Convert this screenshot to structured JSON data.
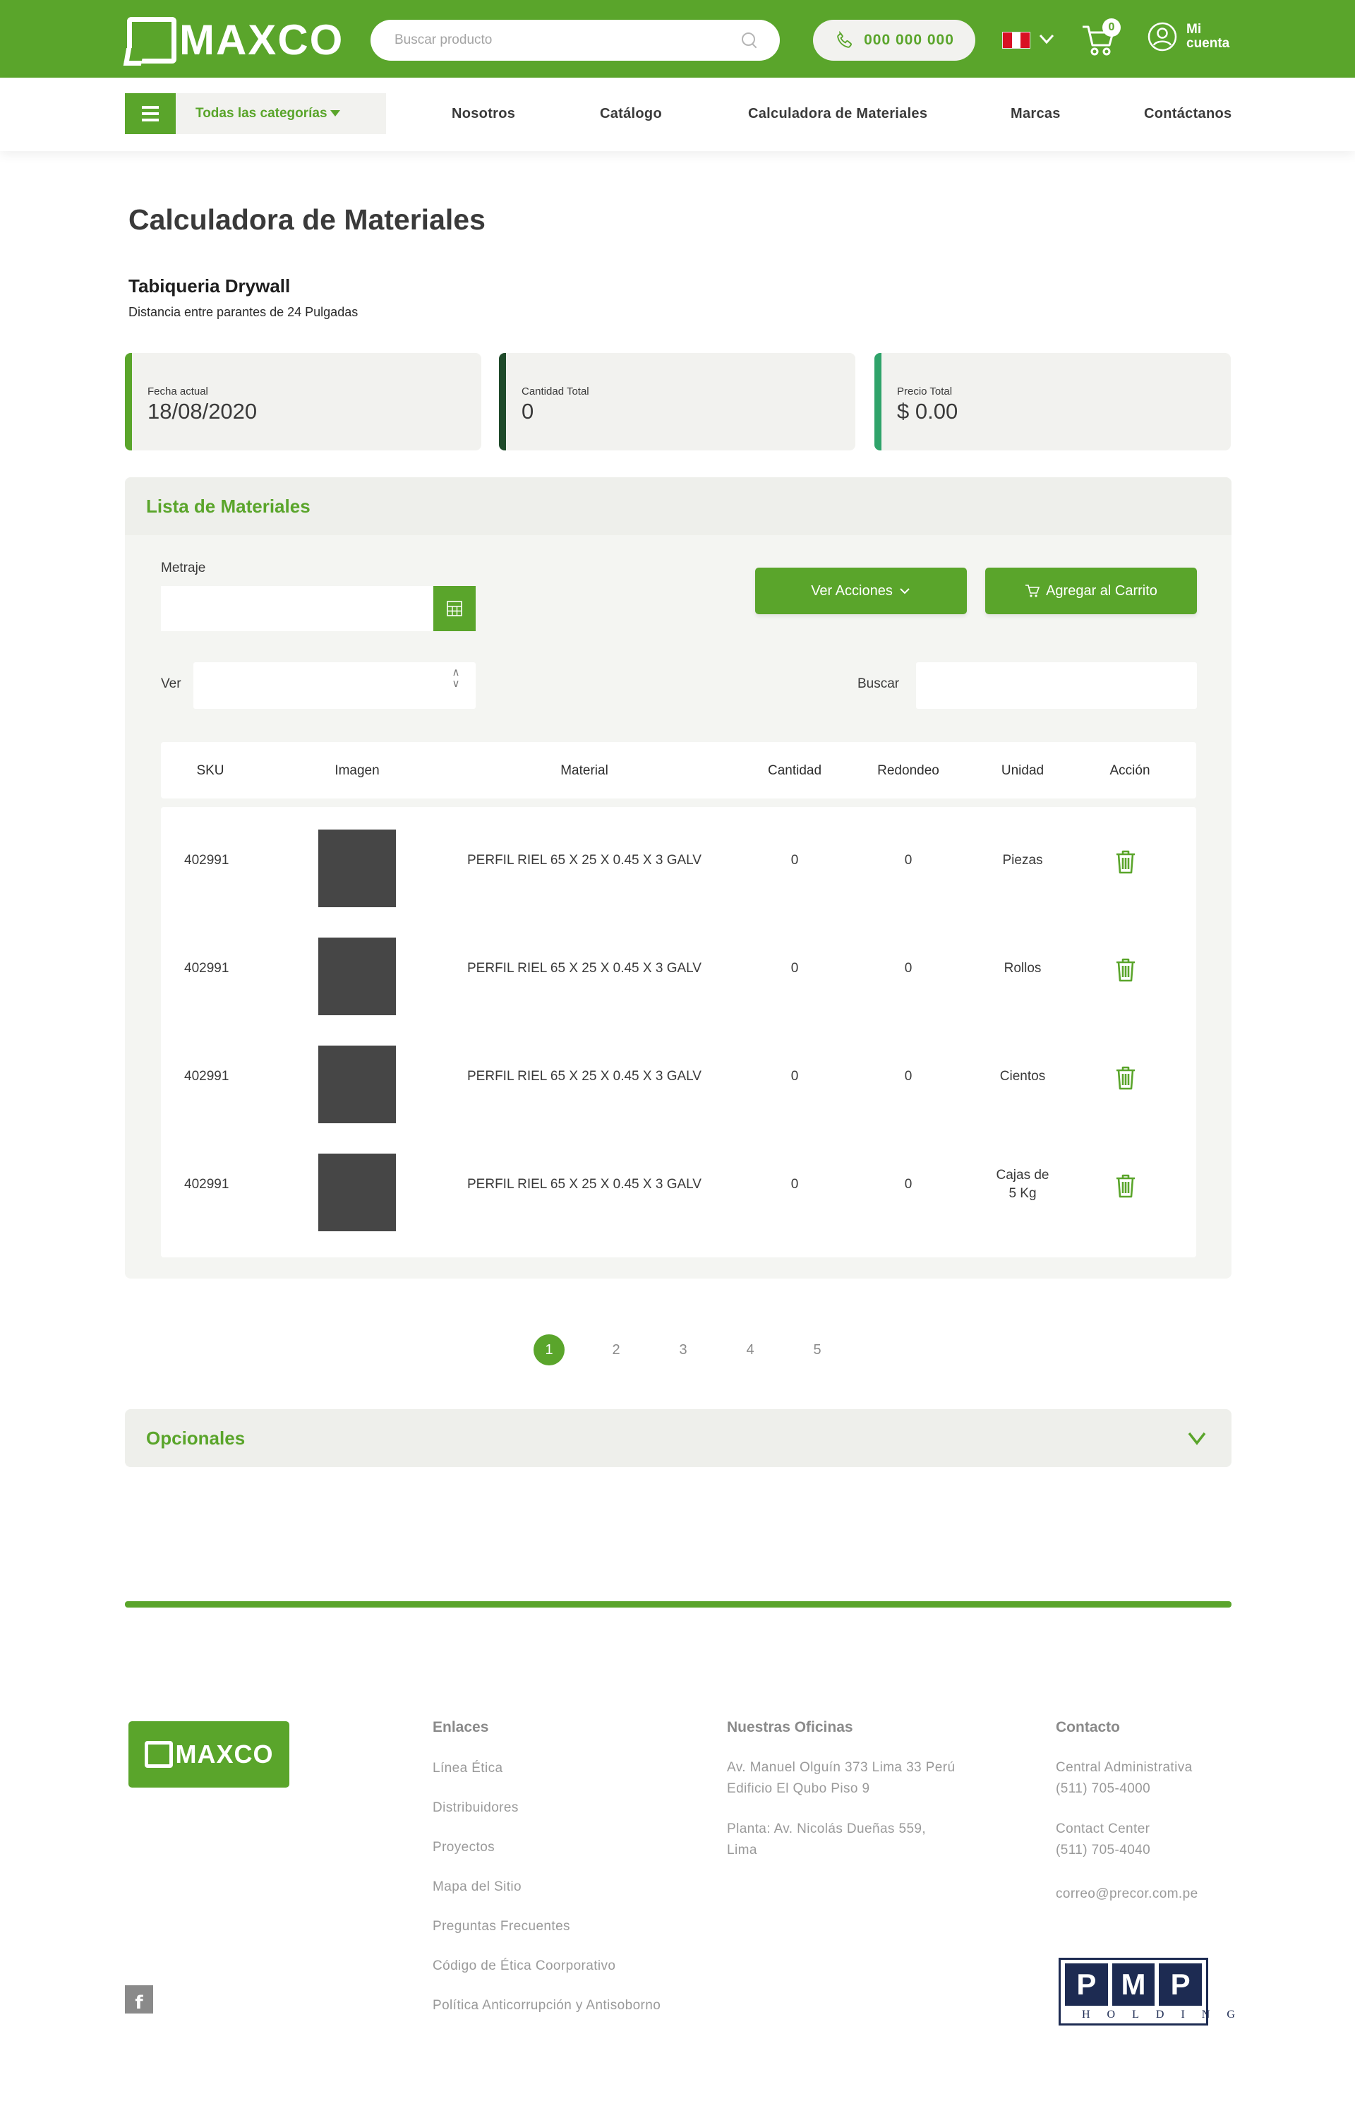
{
  "header": {
    "logo_text": "MAXCO",
    "search_placeholder": "Buscar producto",
    "phone": "000 000 000",
    "cart_count": "0",
    "account_label": "Mi cuenta"
  },
  "nav": {
    "categories_label": "Todas las categorías",
    "links": [
      "Nosotros",
      "Catálogo",
      "Calculadora de Materiales",
      "Marcas",
      "Contáctanos"
    ]
  },
  "page": {
    "title": "Calculadora de Materiales",
    "section_title": "Tabiqueria Drywall",
    "section_subtitle": "Distancia entre parantes de 24 Pulgadas"
  },
  "stats": [
    {
      "label": "Fecha actual",
      "value": "18/08/2020",
      "accent": "#5aa52b"
    },
    {
      "label": "Cantidad Total",
      "value": "0",
      "accent": "#1f4a2a"
    },
    {
      "label": "Precio Total",
      "value": "$ 0.00",
      "accent": "#2fa36a"
    }
  ],
  "materials": {
    "title": "Lista de Materiales",
    "metraje_label": "Metraje",
    "metraje_value": "",
    "ver_label": "Ver",
    "ver_value": "",
    "buscar_label": "Buscar",
    "buscar_value": "",
    "actions_button": "Ver Acciones",
    "cart_button": "Agregar al Carrito",
    "columns": [
      "SKU",
      "Imagen",
      "Material",
      "Cantidad",
      "Redondeo",
      "Unidad",
      "Acción"
    ],
    "rows": [
      {
        "sku": "402991",
        "material": "PERFIL RIEL 65 X 25 X 0.45 X 3 GALV",
        "cantidad": "0",
        "redondeo": "0",
        "unidad": "Piezas"
      },
      {
        "sku": "402991",
        "material": "PERFIL RIEL 65 X 25 X 0.45 X 3 GALV",
        "cantidad": "0",
        "redondeo": "0",
        "unidad": "Rollos"
      },
      {
        "sku": "402991",
        "material": "PERFIL RIEL 65 X 25 X 0.45 X 3 GALV",
        "cantidad": "0",
        "redondeo": "0",
        "unidad": "Cientos"
      },
      {
        "sku": "402991",
        "material": "PERFIL RIEL 65 X 25 X 0.45 X 3 GALV",
        "cantidad": "0",
        "redondeo": "0",
        "unidad": "Cajas de 5 Kg"
      }
    ]
  },
  "pagination": {
    "pages": [
      "1",
      "2",
      "3",
      "4",
      "5"
    ],
    "current": "1"
  },
  "optionals": {
    "title": "Opcionales"
  },
  "footer": {
    "logo_text": "MAXCO",
    "facebook_glyph": "f",
    "enlaces_title": "Enlaces",
    "enlaces": [
      "Línea Ética",
      "Distribuidores",
      "Proyectos",
      "Mapa del Sitio",
      "Preguntas Frecuentes",
      "Código de Ética Coorporativo",
      "Política Anticorrupción y Antisoborno"
    ],
    "oficinas_title": "Nuestras Oficinas",
    "oficina_1_line1": "Av. Manuel Olguín 373 Lima 33 Perú",
    "oficina_1_line2": "Edificio El Qubo Piso 9",
    "oficina_2_line1": "Planta: Av. Nicolás Dueñas 559,",
    "oficina_2_line2": "Lima",
    "contacto_title": "Contacto",
    "central_label": "Central Administrativa",
    "central_phone": "(511) 705-4000",
    "contact_center_label": "Contact Center",
    "contact_center_phone": "(511) 705-4040",
    "email": "correo@precor.com.pe",
    "pmp_letters": [
      "P",
      "M",
      "P"
    ],
    "pmp_sub": "HOLDING"
  },
  "colors": {
    "brand_green": "#5aa52b",
    "panel_bg": "#f4f5f2",
    "dark_text": "#3a3a3a"
  }
}
